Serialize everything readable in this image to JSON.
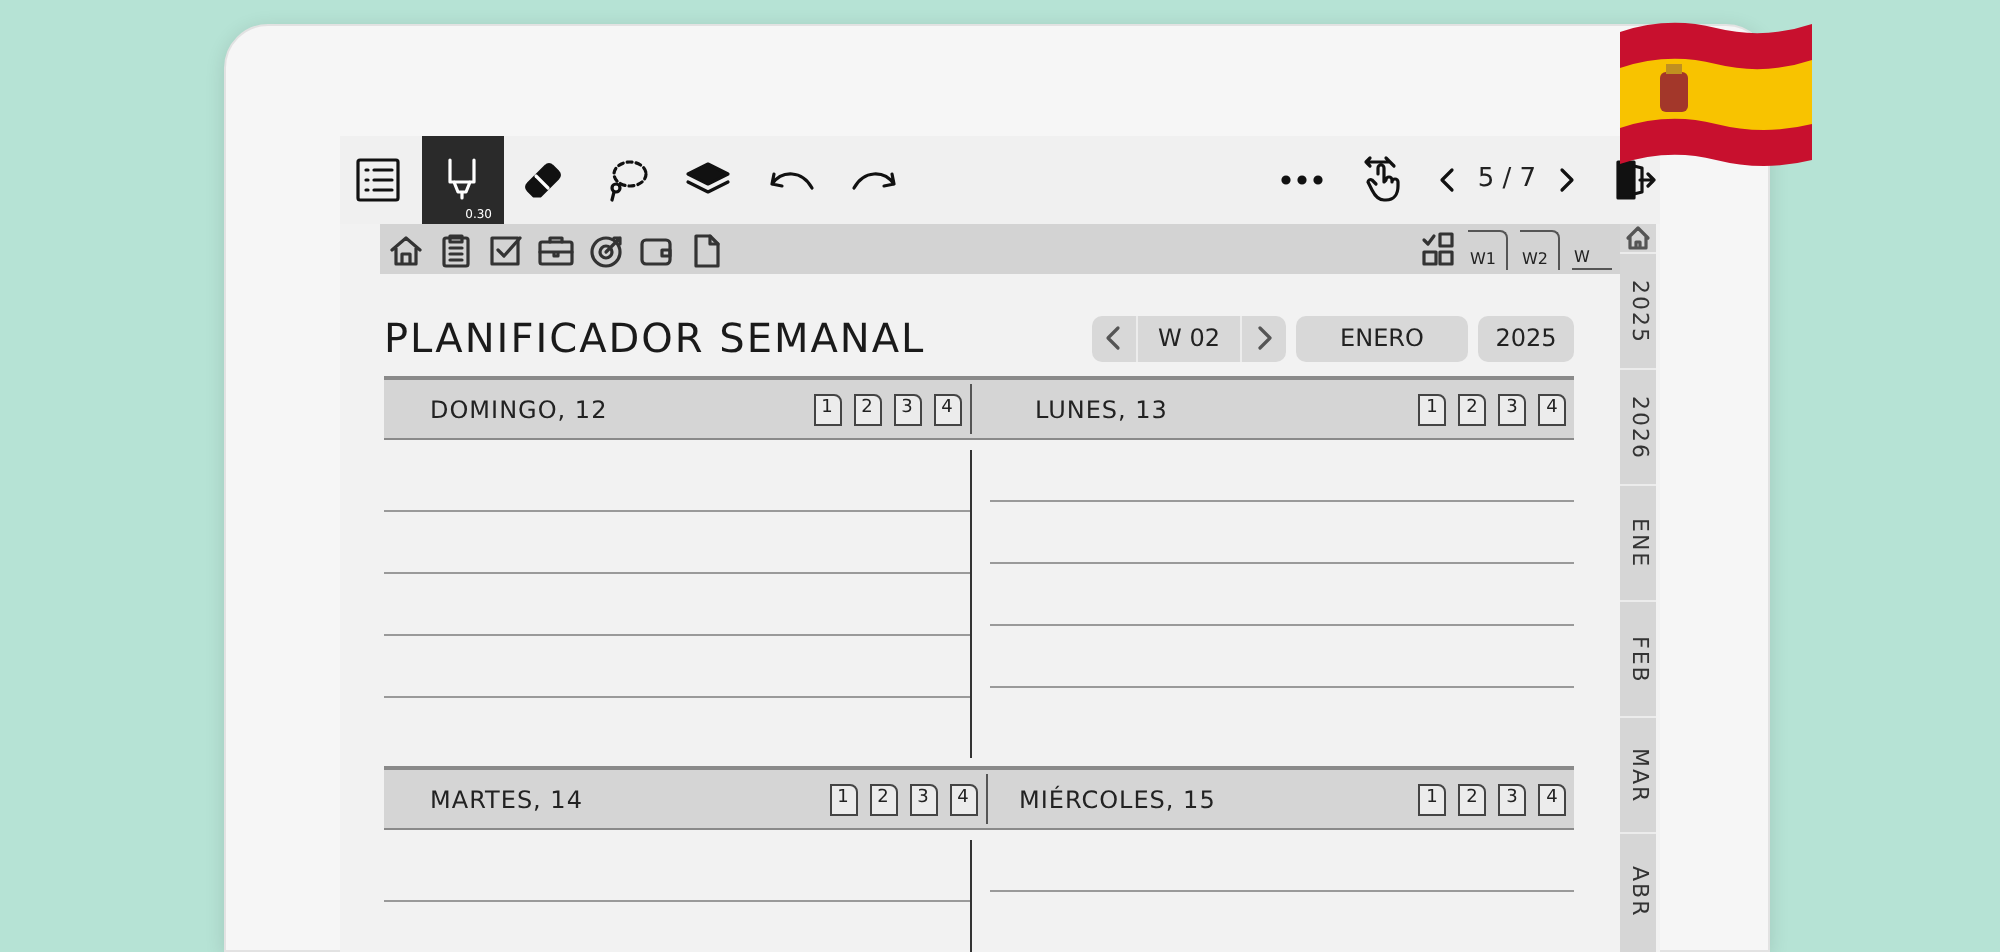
{
  "toolbar": {
    "tools": [
      {
        "kind": "pen",
        "selected": true,
        "size": "0.30"
      },
      {
        "kind": "eraser",
        "selected": false
      },
      {
        "kind": "lasso",
        "selected": false
      },
      {
        "kind": "layers",
        "selected": false
      },
      {
        "kind": "undo",
        "selected": false
      },
      {
        "kind": "redo",
        "selected": false
      }
    ],
    "page": "5 / 7"
  },
  "subbar": {
    "left": [
      {
        "kind": "home"
      },
      {
        "kind": "clipboard"
      },
      {
        "kind": "check"
      },
      {
        "kind": "briefcase"
      },
      {
        "kind": "target"
      },
      {
        "kind": "wallet"
      },
      {
        "kind": "page"
      }
    ],
    "right": [
      {
        "kind": "grid"
      },
      {
        "kind": "week",
        "label": "W1"
      },
      {
        "kind": "week",
        "label": "W2"
      },
      {
        "kind": "thumb",
        "label": "W"
      }
    ]
  },
  "planner": {
    "title": "PLANIFICADOR SEMANAL",
    "week": "W 02",
    "month": "ENERO",
    "year": "2025",
    "sections": [
      {
        "days": [
          {
            "name": "DOMINGO, 12",
            "pages": [
              "1",
              "2",
              "3",
              "4"
            ]
          },
          {
            "name": "LUNES, 13",
            "pages": [
              "1",
              "2",
              "3",
              "4"
            ]
          }
        ]
      },
      {
        "days": [
          {
            "name": "MARTES, 14",
            "pages": [
              "1",
              "2",
              "3",
              "4"
            ]
          },
          {
            "name": "MIÉRCOLES, 15",
            "pages": [
              "1",
              "2",
              "3",
              "4"
            ]
          }
        ]
      }
    ]
  },
  "side_tabs": [
    "2025",
    "2026",
    "ENE",
    "FEB",
    "MAR",
    "ABR"
  ]
}
